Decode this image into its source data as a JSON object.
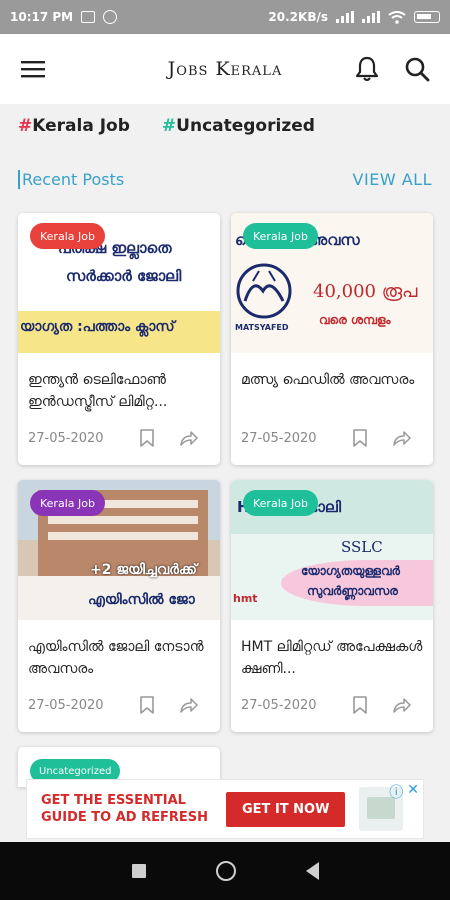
{
  "status_bar": {
    "time": "10:17 PM",
    "network_speed": "20.2KB/s"
  },
  "app_bar": {
    "title": "Jobs Kerala",
    "menu_icon": "hamburger-menu-icon",
    "bell_icon": "bell-icon",
    "search_icon": "search-icon"
  },
  "tags": [
    {
      "hash": "#",
      "label": "Kerala Job",
      "color": "#e8314b"
    },
    {
      "hash": "#",
      "label": "Uncategorized",
      "color": "#1fbf9a"
    }
  ],
  "section": {
    "title": "Recent Posts",
    "view_all": "VIEW ALL"
  },
  "posts": [
    {
      "badge": "Kerala Job",
      "badge_color": "#e8413b",
      "title": "ഇന്ത്യൻ ടെലിഫോൺ ഇൻഡസ്ട്രീസ് ലിമിറ്റ...",
      "date": "27-05-2020",
      "thumb_lines": [
        "പരീക്ഷ ഇല്ലാതെ",
        "സർക്കാർ ജോലി",
        "യാഗ്യത :പത്താം ക്ലാസ്"
      ]
    },
    {
      "badge": "Kerala Job",
      "badge_color": "#1fbf9a",
      "title": "മത്സ്യ ഫെഡിൽ അവസരം",
      "date": "27-05-2020",
      "thumb_lines": [
        "ഫെഡിൽ അവസ",
        "40,000 രൂപ",
        "വരെ ശമ്പളം",
        "MATSYAFED"
      ]
    },
    {
      "badge": "Kerala Job",
      "badge_color": "#8a35b8",
      "title": "എയിംസിൽ ജോലി നേടാൻ അവസരം",
      "date": "27-05-2020",
      "thumb_lines": [
        "+2 ജയിച്ചവർക്ക്",
        "എയിംസിൽ ജോ"
      ]
    },
    {
      "badge": "Kerala Job",
      "badge_color": "#1fbf9a",
      "title": "HMT ലിമിറ്റഡ് അപേക്ഷകൾ ക്ഷണി...",
      "date": "27-05-2020",
      "thumb_lines": [
        "HMTൽ ജോലി",
        "SSLC",
        "യോഗ്യതയുള്ളവർ",
        "സുവർണ്ണാവസര",
        "hmt"
      ]
    }
  ],
  "partial_post": {
    "badge": "Uncategorized"
  },
  "ad": {
    "text": "GET THE ESSENTIAL GUIDE TO AD REFRESH",
    "button": "GET IT NOW"
  }
}
